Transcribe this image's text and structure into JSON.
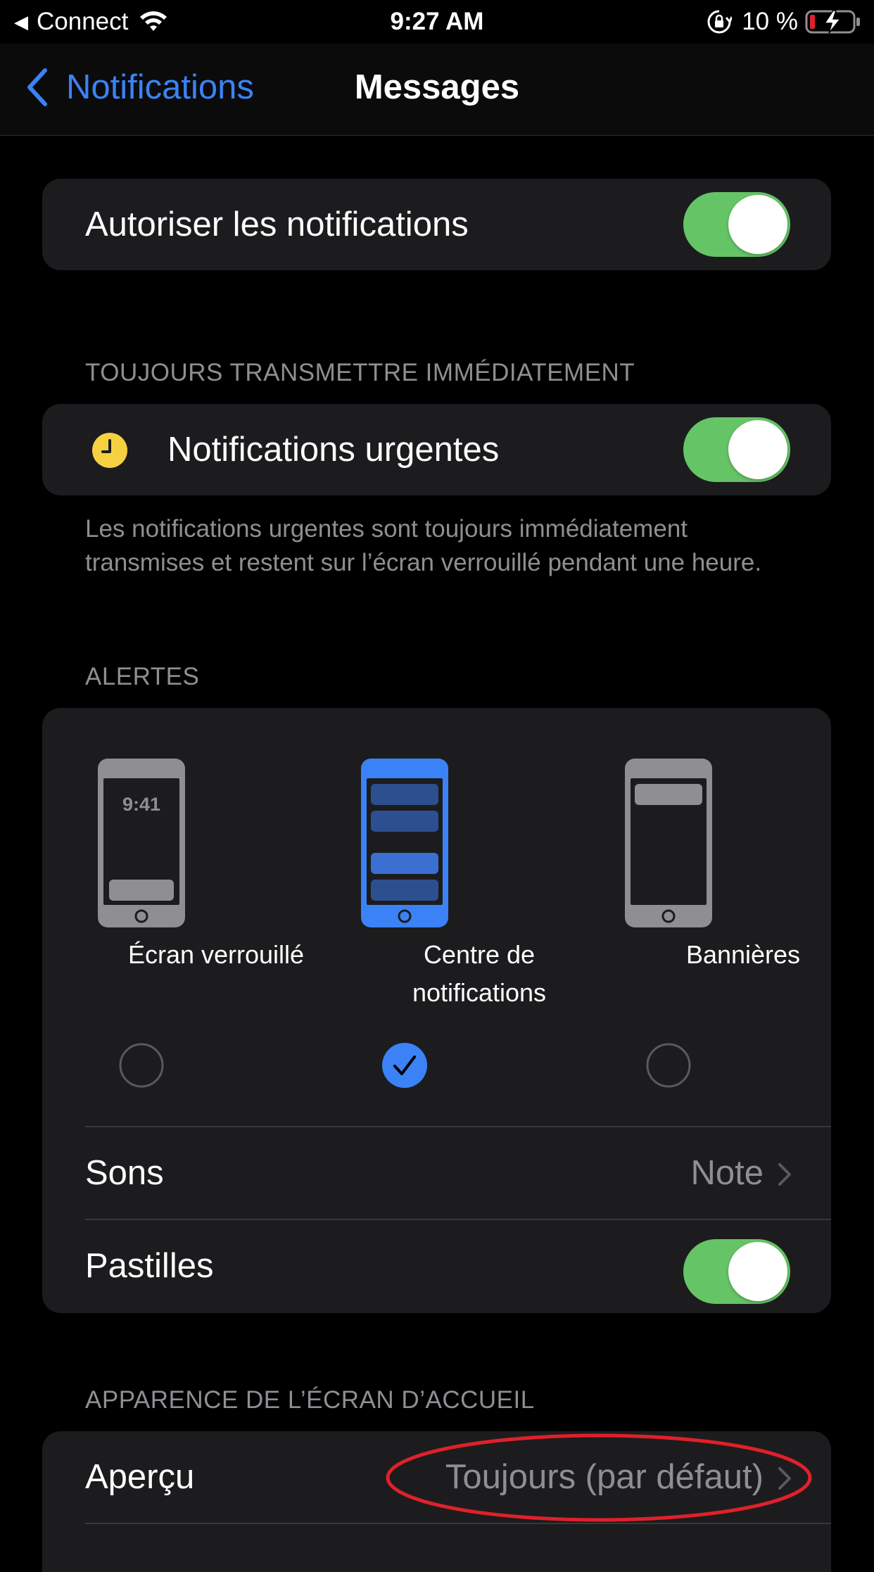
{
  "status_bar": {
    "back_app": "Connect",
    "time": "9:27 AM",
    "battery": "10 %"
  },
  "nav": {
    "back_label": "Notifications",
    "title": "Messages"
  },
  "allow_notifications": {
    "label": "Autoriser les notifications",
    "enabled": true
  },
  "urgent_section": {
    "header": "TOUJOURS TRANSMETTRE IMMÉDIATEMENT",
    "label": "Notifications urgentes",
    "enabled": true,
    "icon": "clock-icon",
    "footer": "Les notifications urgentes sont toujours immédiatement transmises et restent sur l’écran verrouillé pendant une heure."
  },
  "alerts_section": {
    "header": "ALERTES",
    "options": [
      {
        "label": "Écran verrouillé",
        "selected": false,
        "phone_time": "9:41"
      },
      {
        "label_line1": "Centre de",
        "label_line2": "notifications",
        "selected": true
      },
      {
        "label": "Bannières",
        "selected": false
      }
    ],
    "sounds": {
      "label": "Sons",
      "value": "Note"
    },
    "badges": {
      "label": "Pastilles",
      "enabled": true
    }
  },
  "home_screen_section": {
    "header": "APPARENCE DE L’ÉCRAN D’ACCUEIL",
    "preview": {
      "label": "Aperçu",
      "value": "Toujours (par défaut)"
    }
  },
  "colors": {
    "accent": "#3b82f6",
    "toggle_on": "#65c466",
    "cell_background": "#1c1c1e",
    "secondary_text": "#8e8e93",
    "annotation": "#e0202a"
  }
}
